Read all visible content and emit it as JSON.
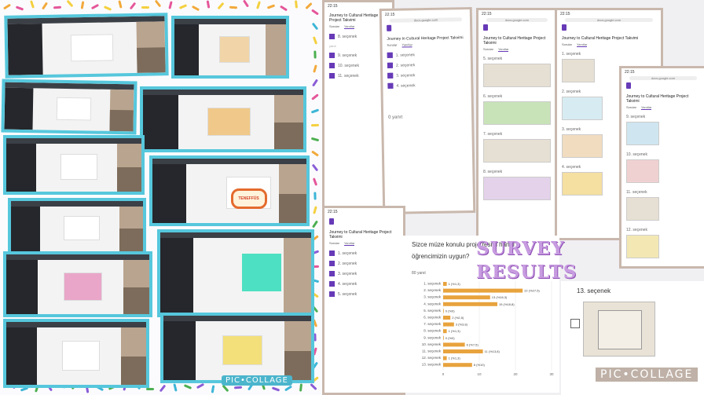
{
  "collage_left": {
    "watermark": "PIC•COLLAGE",
    "canvas_badge": "TENEFFÜS"
  },
  "forms": {
    "status_time": "22:15",
    "url": "docs.google.com",
    "form_title": "Journey to Cultural Heritage Project Takvimi",
    "tab_questions": "Sorular",
    "tab_responses": "Yanıtlar",
    "option_prefix": "seçenek",
    "answers_small": "yanıt",
    "answers_count": "0 yanıt",
    "phone1_options": [
      "8. seçenek",
      "9. seçenek",
      "10. seçenek",
      "11. seçenek"
    ],
    "phone2_options": [
      "1. seçenek",
      "2. seçenek",
      "3. seçenek",
      "4. seçenek"
    ],
    "phone3_options": [
      "5. seçenek",
      "6. seçenek",
      "7. seçenek",
      "8. seçenek"
    ],
    "phone4_options": [
      "1. seçenek",
      "2. seçenek",
      "3. seçenek",
      "4. seçenek"
    ],
    "phone5_options": [
      "9. seçenek",
      "10. seçenek",
      "11. seçenek",
      "12. seçenek"
    ],
    "phone6_options": [
      "1. seçenek",
      "2. seçenek",
      "3. seçenek",
      "4. seçenek",
      "5. seçenek"
    ]
  },
  "survey_label_1": "SURVEY",
  "survey_label_2": "RESULTS",
  "question": {
    "text": "Sizce müze konulu proje resmi hangi öğrencimizin uygun?",
    "responses": "80 yanıt"
  },
  "chart_data": {
    "type": "bar",
    "orientation": "horizontal",
    "categories": [
      "1. seçenek",
      "2. seçenek",
      "3. seçenek",
      "4. seçenek",
      "5. seçenek",
      "6. seçenek",
      "7. seçenek",
      "8. seçenek",
      "9. seçenek",
      "10. seçenek",
      "11. seçenek",
      "12. seçenek",
      "13. seçenek"
    ],
    "values": [
      1,
      22,
      13,
      15,
      0,
      2,
      3,
      1,
      0,
      6,
      11,
      1,
      8
    ],
    "data_labels": [
      "1 (%1,3)",
      "22 (%27,5)",
      "13 (%16,3)",
      "15 (%18,8)",
      "0 (%0)",
      "2 (%2,5)",
      "3 (%3,8)",
      "1 (%1,3)",
      "0 (%0)",
      "6 (%7,5)",
      "11 (%13,8)",
      "1 (%1,3)",
      "8 (%10)"
    ],
    "xticks": [
      "0",
      "10",
      "20",
      "30"
    ],
    "xlim": [
      0,
      30
    ],
    "color": "#e8a33d"
  },
  "selection_13": {
    "label": "13. seçenek"
  },
  "watermark_right": "PIC•COLLAGE"
}
